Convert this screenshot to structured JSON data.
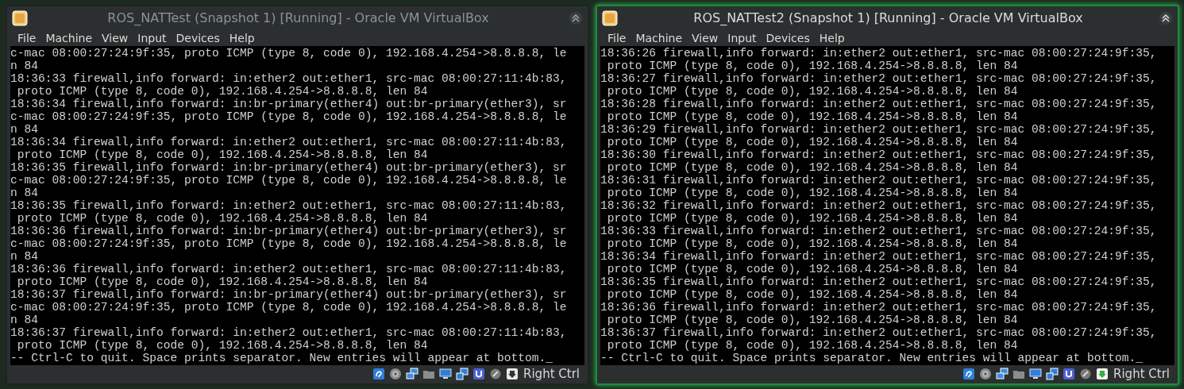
{
  "windows": [
    {
      "title": "ROS_NATTest (Snapshot 1) [Running] - Oracle VM VirtualBox",
      "active": false,
      "menu": [
        "File",
        "Machine",
        "View",
        "Input",
        "Devices",
        "Help"
      ],
      "terminal_lines": [
        "c-mac 08:00:27:24:9f:35, proto ICMP (type 8, code 0), 192.168.4.254->8.8.8.8, le",
        "n 84",
        "18:36:33 firewall,info forward: in:ether2 out:ether1, src-mac 08:00:27:11:4b:83,",
        " proto ICMP (type 8, code 0), 192.168.4.254->8.8.8.8, len 84",
        "18:36:34 firewall,info forward: in:br-primary(ether4) out:br-primary(ether3), sr",
        "c-mac 08:00:27:24:9f:35, proto ICMP (type 8, code 0), 192.168.4.254->8.8.8.8, le",
        "n 84",
        "18:36:34 firewall,info forward: in:ether2 out:ether1, src-mac 08:00:27:11:4b:83,",
        " proto ICMP (type 8, code 0), 192.168.4.254->8.8.8.8, len 84",
        "18:36:35 firewall,info forward: in:br-primary(ether4) out:br-primary(ether3), sr",
        "c-mac 08:00:27:24:9f:35, proto ICMP (type 8, code 0), 192.168.4.254->8.8.8.8, le",
        "n 84",
        "18:36:35 firewall,info forward: in:ether2 out:ether1, src-mac 08:00:27:11:4b:83,",
        " proto ICMP (type 8, code 0), 192.168.4.254->8.8.8.8, len 84",
        "18:36:36 firewall,info forward: in:br-primary(ether4) out:br-primary(ether3), sr",
        "c-mac 08:00:27:24:9f:35, proto ICMP (type 8, code 0), 192.168.4.254->8.8.8.8, le",
        "n 84",
        "18:36:36 firewall,info forward: in:ether2 out:ether1, src-mac 08:00:27:11:4b:83,",
        " proto ICMP (type 8, code 0), 192.168.4.254->8.8.8.8, len 84",
        "18:36:37 firewall,info forward: in:br-primary(ether4) out:br-primary(ether3), sr",
        "c-mac 08:00:27:24:9f:35, proto ICMP (type 8, code 0), 192.168.4.254->8.8.8.8, le",
        "n 84",
        "18:36:37 firewall,info forward: in:ether2 out:ether1, src-mac 08:00:27:11:4b:83,",
        " proto ICMP (type 8, code 0), 192.168.4.254->8.8.8.8, len 84",
        "-- Ctrl-C to quit. Space prints separator. New entries will appear at bottom._"
      ],
      "host_key": "Right Ctrl"
    },
    {
      "title": "ROS_NATTest2 (Snapshot 1) [Running] - Oracle VM VirtualBox",
      "active": true,
      "menu": [
        "File",
        "Machine",
        "View",
        "Input",
        "Devices",
        "Help"
      ],
      "terminal_lines": [
        "18:36:26 firewall,info forward: in:ether2 out:ether1, src-mac 08:00:27:24:9f:35,",
        " proto ICMP (type 8, code 0), 192.168.4.254->8.8.8.8, len 84",
        "18:36:27 firewall,info forward: in:ether2 out:ether1, src-mac 08:00:27:24:9f:35,",
        " proto ICMP (type 8, code 0), 192.168.4.254->8.8.8.8, len 84",
        "18:36:28 firewall,info forward: in:ether2 out:ether1, src-mac 08:00:27:24:9f:35,",
        " proto ICMP (type 8, code 0), 192.168.4.254->8.8.8.8, len 84",
        "18:36:29 firewall,info forward: in:ether2 out:ether1, src-mac 08:00:27:24:9f:35,",
        " proto ICMP (type 8, code 0), 192.168.4.254->8.8.8.8, len 84",
        "18:36:30 firewall,info forward: in:ether2 out:ether1, src-mac 08:00:27:24:9f:35,",
        " proto ICMP (type 8, code 0), 192.168.4.254->8.8.8.8, len 84",
        "18:36:31 firewall,info forward: in:ether2 out:ether1, src-mac 08:00:27:24:9f:35,",
        " proto ICMP (type 8, code 0), 192.168.4.254->8.8.8.8, len 84",
        "18:36:32 firewall,info forward: in:ether2 out:ether1, src-mac 08:00:27:24:9f:35,",
        " proto ICMP (type 8, code 0), 192.168.4.254->8.8.8.8, len 84",
        "18:36:33 firewall,info forward: in:ether2 out:ether1, src-mac 08:00:27:24:9f:35,",
        " proto ICMP (type 8, code 0), 192.168.4.254->8.8.8.8, len 84",
        "18:36:34 firewall,info forward: in:ether2 out:ether1, src-mac 08:00:27:24:9f:35,",
        " proto ICMP (type 8, code 0), 192.168.4.254->8.8.8.8, len 84",
        "18:36:35 firewall,info forward: in:ether2 out:ether1, src-mac 08:00:27:24:9f:35,",
        " proto ICMP (type 8, code 0), 192.168.4.254->8.8.8.8, len 84",
        "18:36:36 firewall,info forward: in:ether2 out:ether1, src-mac 08:00:27:24:9f:35,",
        " proto ICMP (type 8, code 0), 192.168.4.254->8.8.8.8, len 84",
        "18:36:37 firewall,info forward: in:ether2 out:ether1, src-mac 08:00:27:24:9f:35,",
        " proto ICMP (type 8, code 0), 192.168.4.254->8.8.8.8, len 84",
        "-- Ctrl-C to quit. Space prints separator. New entries will appear at bottom._"
      ],
      "host_key": "Right Ctrl"
    }
  ]
}
